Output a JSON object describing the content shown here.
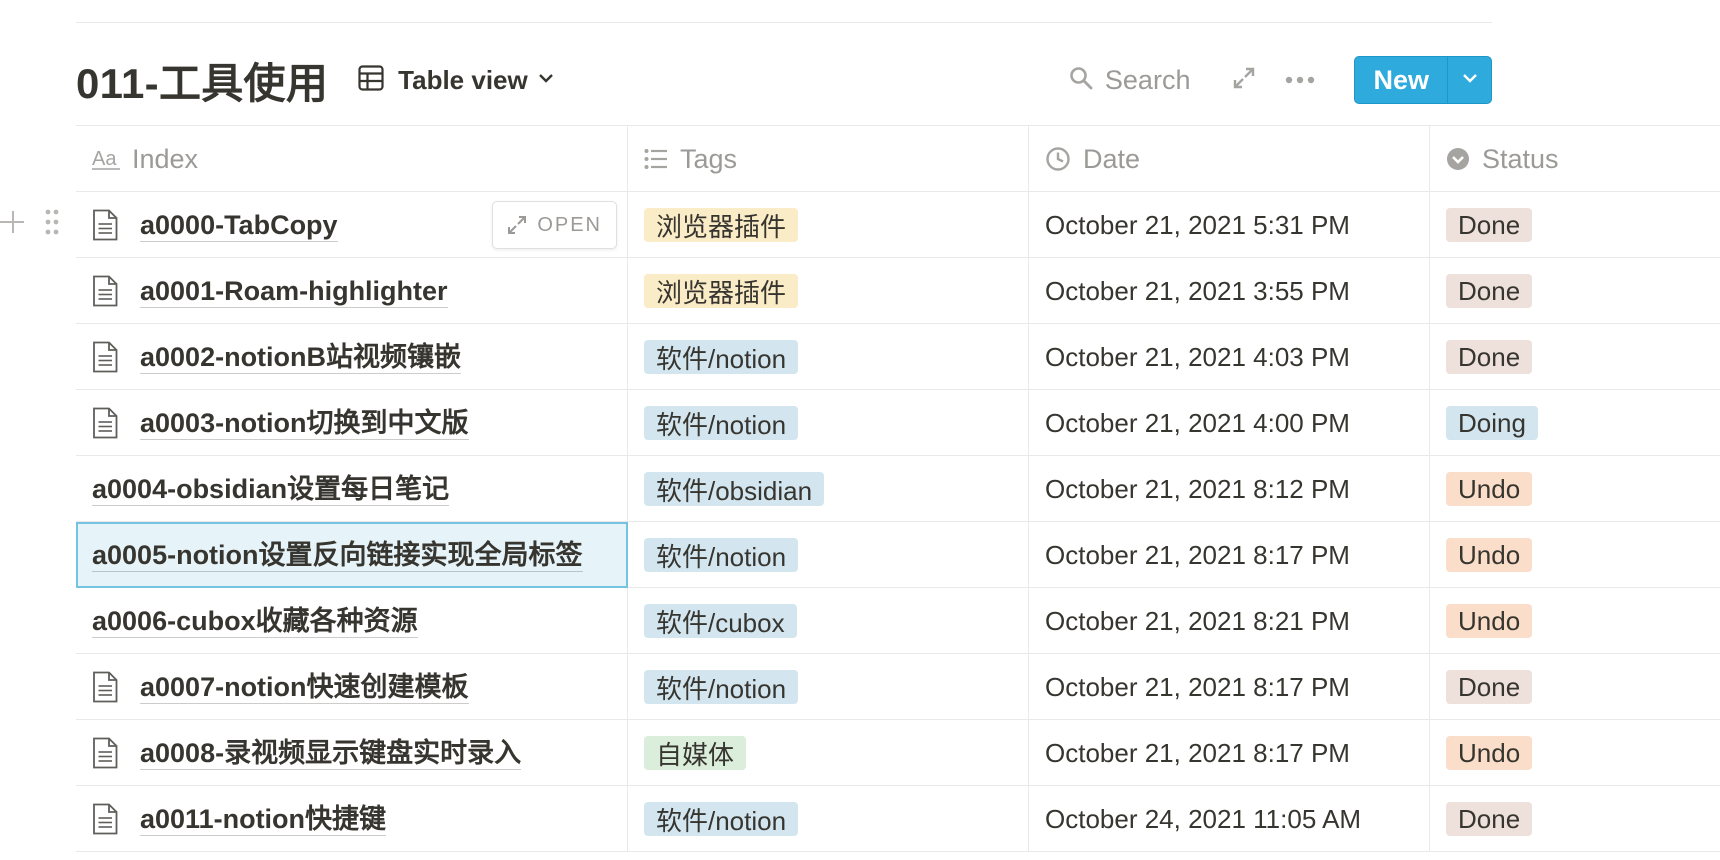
{
  "database": {
    "title": "011-工具使用",
    "view_label": "Table view",
    "view_icon": "table-icon"
  },
  "toolbar": {
    "search_label": "Search",
    "new_label": "New"
  },
  "open_label": "OPEN",
  "columns": [
    {
      "label": "Index",
      "icon": "text-aa-icon"
    },
    {
      "label": "Tags",
      "icon": "multiselect-list-icon"
    },
    {
      "label": "Date",
      "icon": "clock-icon"
    },
    {
      "label": "Status",
      "icon": "status-select-icon"
    }
  ],
  "rows": [
    {
      "title": "a0000-TabCopy",
      "has_icon": true,
      "tag": "浏览器插件",
      "tag_color": "#fbecc8",
      "date": "October 21, 2021 5:31 PM",
      "status": "Done",
      "status_color": "#eee0da"
    },
    {
      "title": "a0001-Roam-highlighter",
      "has_icon": true,
      "tag": "浏览器插件",
      "tag_color": "#fbecc8",
      "date": "October 21, 2021 3:55 PM",
      "status": "Done",
      "status_color": "#eee0da"
    },
    {
      "title": "a0002-notionB站视频镶嵌",
      "has_icon": true,
      "tag": "软件/notion",
      "tag_color": "#d3e5ef",
      "date": "October 21, 2021 4:03 PM",
      "status": "Done",
      "status_color": "#eee0da"
    },
    {
      "title": "a0003-notion切换到中文版",
      "has_icon": true,
      "tag": "软件/notion",
      "tag_color": "#d3e5ef",
      "date": "October 21, 2021 4:00 PM",
      "status": "Doing",
      "status_color": "#d3e5ef"
    },
    {
      "title": "a0004-obsidian设置每日笔记",
      "has_icon": false,
      "tag": "软件/obsidian",
      "tag_color": "#d3e5ef",
      "date": "October 21, 2021 8:12 PM",
      "status": "Undo",
      "status_color": "#fadec9"
    },
    {
      "title": "a0005-notion设置反向链接实现全局标签",
      "has_icon": false,
      "tag": "软件/notion",
      "tag_color": "#d3e5ef",
      "date": "October 21, 2021 8:17 PM",
      "status": "Undo",
      "status_color": "#fadec9"
    },
    {
      "title": "a0006-cubox收藏各种资源",
      "has_icon": false,
      "tag": "软件/cubox",
      "tag_color": "#d3e5ef",
      "date": "October 21, 2021 8:21 PM",
      "status": "Undo",
      "status_color": "#fadec9"
    },
    {
      "title": "a0007-notion快速创建模板",
      "has_icon": true,
      "tag": "软件/notion",
      "tag_color": "#d3e5ef",
      "date": "October 21, 2021 8:17 PM",
      "status": "Done",
      "status_color": "#eee0da"
    },
    {
      "title": "a0008-录视频显示键盘实时录入",
      "has_icon": true,
      "tag": "自媒体",
      "tag_color": "#dbeddb",
      "date": "October 21, 2021 8:17 PM",
      "status": "Undo",
      "status_color": "#fadec9"
    },
    {
      "title": "a0011-notion快捷键",
      "has_icon": true,
      "tag": "软件/notion",
      "tag_color": "#d3e5ef",
      "date": "October 24, 2021 11:05 AM",
      "status": "Done",
      "status_color": "#eee0da"
    }
  ]
}
